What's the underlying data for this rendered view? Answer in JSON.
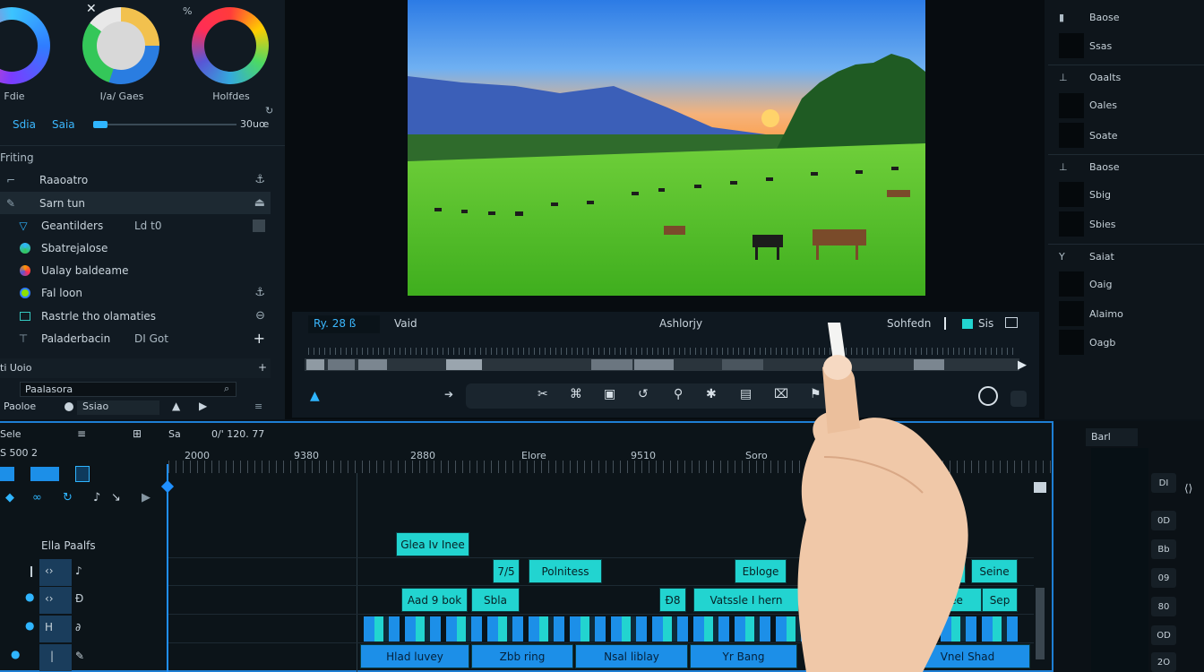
{
  "color_panel": {
    "wheel_labels": [
      "Fdie",
      "I/a/ Gaes",
      "Holfdes"
    ],
    "top_icons": [
      "close-icon",
      "percent-icon"
    ],
    "slider": {
      "label_1": "Sdia",
      "label_2": "Saia",
      "value": "30uœ"
    }
  },
  "tools": {
    "section_title": "Friting",
    "items": [
      {
        "label": "Raaoatro",
        "value": "",
        "icon": "crop-icon",
        "action": "anchor-icon"
      },
      {
        "label": "Sarn tun",
        "value": "",
        "icon": "pen-icon",
        "action": "stamp-icon"
      },
      {
        "label": "Geantilders",
        "value": "Ld t0",
        "icon": "triangle-icon",
        "action": "square-icon"
      },
      {
        "label": "Sbatrejalose",
        "value": "",
        "icon": "globe-icon",
        "action": ""
      },
      {
        "label": "Ualay baldeame",
        "value": "",
        "icon": "color-dot-icon",
        "action": ""
      },
      {
        "label": "Fal loon",
        "value": "",
        "icon": "green-dot-icon",
        "action": "anchor-icon"
      },
      {
        "label": "Rastrle tho olamaties",
        "value": "",
        "icon": "frame-icon",
        "action": "minus-circle-icon"
      },
      {
        "label": "Paladerbacin",
        "value": "DI Got",
        "icon": "text-icon",
        "action": "plus-icon"
      }
    ],
    "subsection_title": "ti Uoio",
    "search_label": "Paalasora",
    "bottom_row": {
      "label": "Paoloe",
      "value": "Ssiao"
    }
  },
  "preview": {
    "controls": {
      "timecode": "Ry. 28 ß",
      "mode": "Vaid",
      "center_label": "Ashlorjy",
      "right_label": "Sohfedn",
      "right_value": "Sis"
    }
  },
  "right_panel": {
    "sections": [
      {
        "header": "Baose",
        "swatches": [
          "Ssas"
        ]
      },
      {
        "header": "Oaalts",
        "swatches": [
          "Oales",
          "Soate"
        ]
      },
      {
        "header": "Baose",
        "swatches": [
          "Sbig",
          "Sbies"
        ]
      },
      {
        "header": "Saiat",
        "swatches": [
          "Oaig",
          "Alaimo",
          "Oagb"
        ]
      }
    ]
  },
  "timeline": {
    "header": {
      "item_1": "Sele",
      "item_2": "Sa",
      "item_3": "0/' 120. 77",
      "timecode": "S 500 2"
    },
    "tracks_title": "Ella Paalfs",
    "ruler": [
      "2000",
      "9380",
      "2880",
      "Elore",
      "9510",
      "Soro"
    ],
    "clips_row_1": [
      "Glea Iv Inee"
    ],
    "clips_row_2": [
      "7/5",
      "Polnitess",
      "Ebloge",
      "I",
      "40",
      "Seine"
    ],
    "clips_row_3": [
      "Aad 9 bok",
      "Sbla",
      "Ð8",
      "Vatssle I hern",
      "Bleee",
      "Sep"
    ],
    "clips_row_5": [
      "Hlad luvey",
      "Zbb ring",
      "Nsal liblay",
      "Yr Bang",
      "Vnel Shad"
    ]
  },
  "right_strip": {
    "header": "Barl",
    "items": [
      "DI",
      "0D",
      "Bb",
      "09",
      "80",
      "OD",
      "2O"
    ]
  }
}
